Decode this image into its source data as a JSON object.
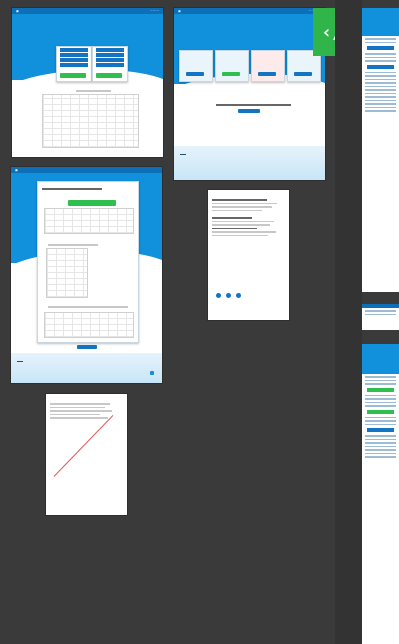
{
  "workspace": {
    "background": "#3a3a3a"
  },
  "accent": {
    "brand_blue": "#1190dc",
    "nav_blue": "#0d6fb8",
    "green": "#2fbf4f"
  },
  "code_tile": {
    "icon": "code-brackets-icon",
    "glyph": "‹/›"
  },
  "artboards": {
    "a1": {
      "title": "",
      "subtitle": ""
    },
    "a2": {
      "title": "",
      "subtitle": ""
    },
    "a3": {
      "title": ""
    },
    "a4": {
      "title": ""
    },
    "a5": {
      "title": ""
    },
    "strip_top": {
      "title": ""
    },
    "strip_bottom": {
      "title": ""
    }
  }
}
